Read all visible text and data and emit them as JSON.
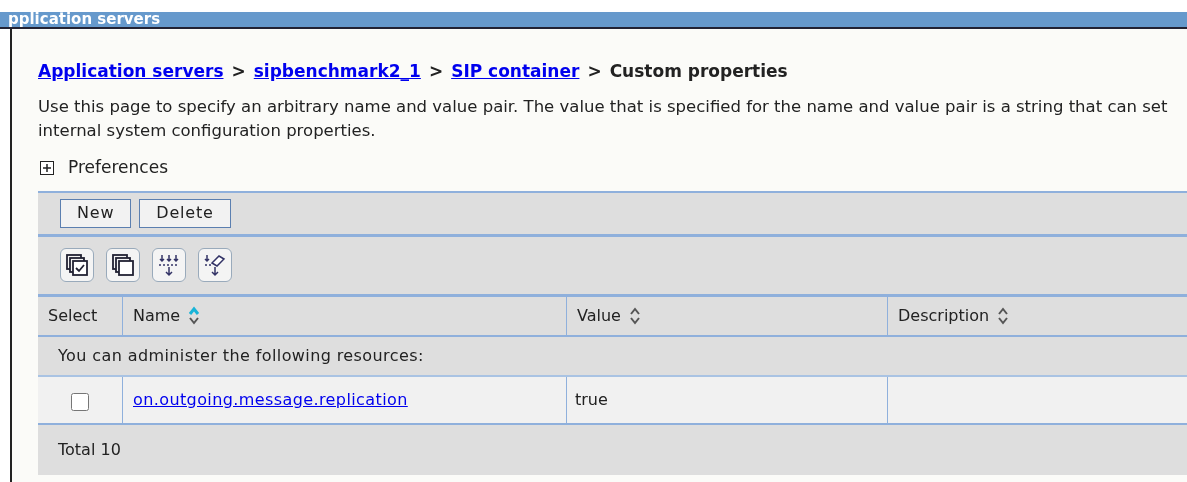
{
  "window": {
    "title": "pplication servers"
  },
  "breadcrumb": [
    {
      "text": "Application servers",
      "kind": "link"
    },
    {
      "text": "sipbenchmark2_1",
      "kind": "link"
    },
    {
      "text": "SIP container",
      "kind": "link"
    },
    {
      "text": "Custom properties",
      "kind": "current"
    }
  ],
  "breadcrumb_separator": ">",
  "description": "Use this page to specify an arbitrary name and value pair. The value that is specified for the name and value pair is a string that can set internal system configuration properties.",
  "preferences": {
    "label": "Preferences",
    "expanded": false
  },
  "buttons": [
    "New",
    "Delete"
  ],
  "table": {
    "columns": [
      {
        "label": "Select"
      },
      {
        "label": "Name",
        "sorted": true
      },
      {
        "label": "Value",
        "sorted": false
      },
      {
        "label": "Description",
        "sorted": false
      }
    ],
    "message": "You can administer the following resources:",
    "rows": [
      {
        "checked": false,
        "name": "on.outgoing.message.replication",
        "value": "true"
      }
    ],
    "total": "Total 10"
  }
}
